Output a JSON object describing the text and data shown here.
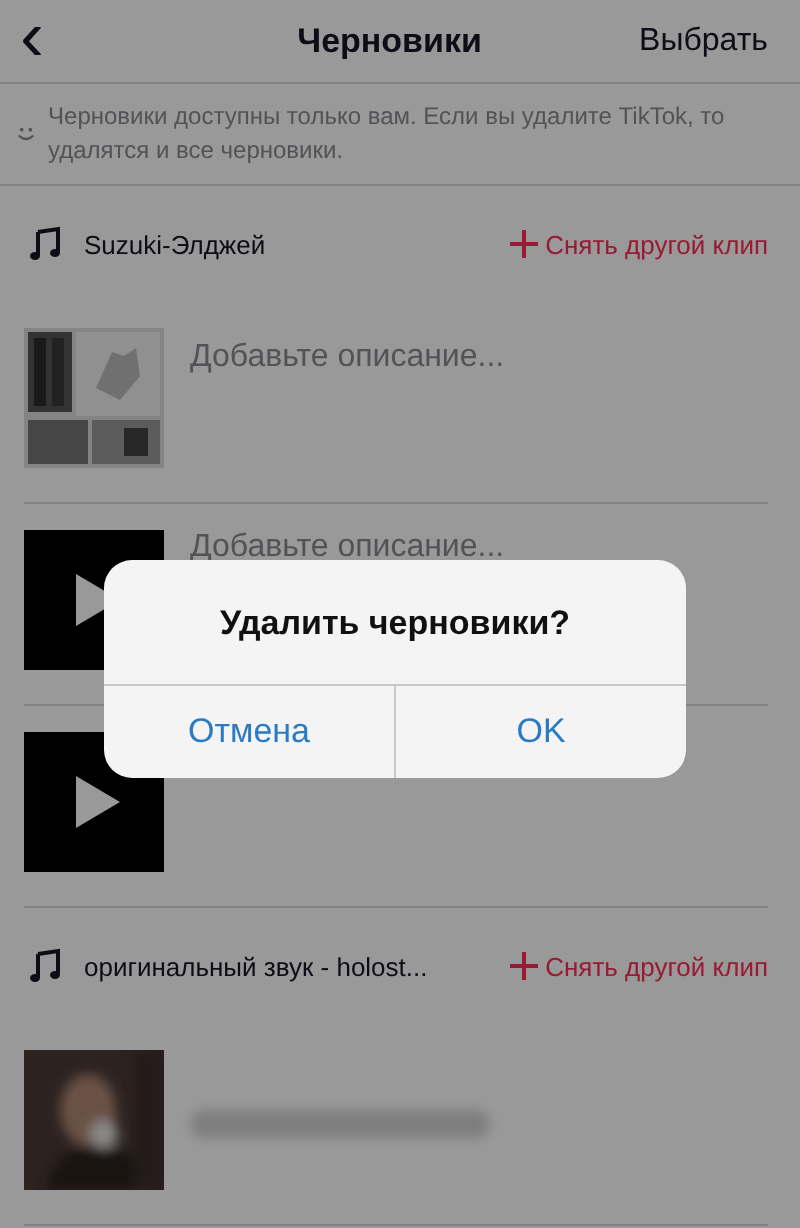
{
  "header": {
    "back_icon": "‹",
    "title": "Черновики",
    "action": "Выбрать"
  },
  "notice": "Черновики доступны только вам. Если вы удалите TikTok, то удалятся и все черновики.",
  "sections": [
    {
      "sound": "Suzuki-Элджей",
      "action": "Снять другой клип",
      "drafts": [
        {
          "description": "Добавьте описание..."
        },
        {
          "kind": "video",
          "description": "Добавьте описание..."
        },
        {
          "kind": "video"
        }
      ]
    },
    {
      "sound": "оригинальный звук - holost...",
      "action": "Снять другой клип",
      "drafts": [
        {
          "kind": "blurred"
        }
      ]
    }
  ],
  "dialog": {
    "title": "Удалить черновики?",
    "buttons": [
      "Отмена",
      "OK"
    ]
  }
}
